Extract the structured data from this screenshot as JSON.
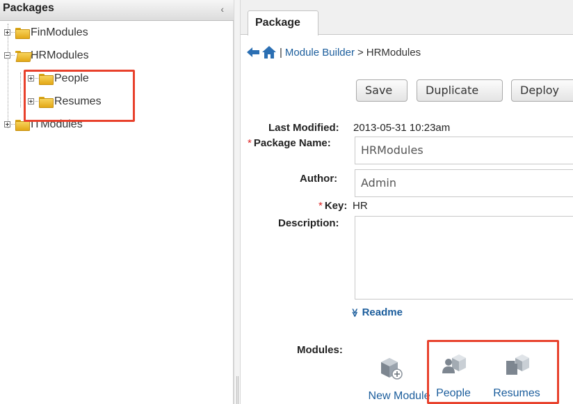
{
  "packages_panel": {
    "title": "Packages",
    "collapse_glyph": "‹",
    "tree": [
      {
        "label": "FinModules",
        "expanded": false
      },
      {
        "label": "HRModules",
        "expanded": true,
        "children": [
          {
            "label": "People"
          },
          {
            "label": "Resumes"
          }
        ]
      },
      {
        "label": "ITModules",
        "expanded": false
      }
    ]
  },
  "tabs": [
    {
      "label": "Package"
    }
  ],
  "breadcrumb": {
    "separator": "|",
    "link": "Module Builder",
    "arrow": ">",
    "current": "HRModules"
  },
  "toolbar": {
    "save": "Save",
    "duplicate": "Duplicate",
    "deploy": "Deploy"
  },
  "form": {
    "last_modified_label": "Last Modified:",
    "last_modified_value": "2013-05-31 10:23am",
    "required_marker": "*",
    "package_name_label": "Package Name:",
    "package_name_value": "HRModules",
    "author_label": "Author:",
    "author_value": "Admin",
    "key_label": "Key:",
    "key_value": "HR",
    "description_label": "Description:",
    "description_value": "",
    "readme_toggle": "Readme",
    "readme_chevron": "≫"
  },
  "modules": {
    "label": "Modules:",
    "items": [
      {
        "label": "New Module",
        "icon": "new-module-icon"
      },
      {
        "label": "People",
        "icon": "person-module-icon"
      },
      {
        "label": "Resumes",
        "icon": "document-module-icon"
      }
    ]
  },
  "colors": {
    "link": "#1b5d9c",
    "highlight": "#e8412c",
    "folder": "#e3a817",
    "required": "#d22222"
  }
}
